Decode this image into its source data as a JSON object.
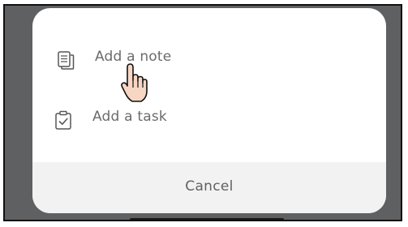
{
  "menu": {
    "items": [
      {
        "label": "Add a note",
        "icon": "note-icon"
      },
      {
        "label": "Add a task",
        "icon": "task-checklist-icon"
      }
    ],
    "cancel_label": "Cancel"
  },
  "colors": {
    "backdrop": "#5f6062",
    "sheet": "#ffffff",
    "cancel_background": "#f2f2f2",
    "text": "#6b6b6b",
    "cursor_fill": "#f7d7c4"
  },
  "cursor": {
    "icon": "hand-pointer-cursor"
  }
}
